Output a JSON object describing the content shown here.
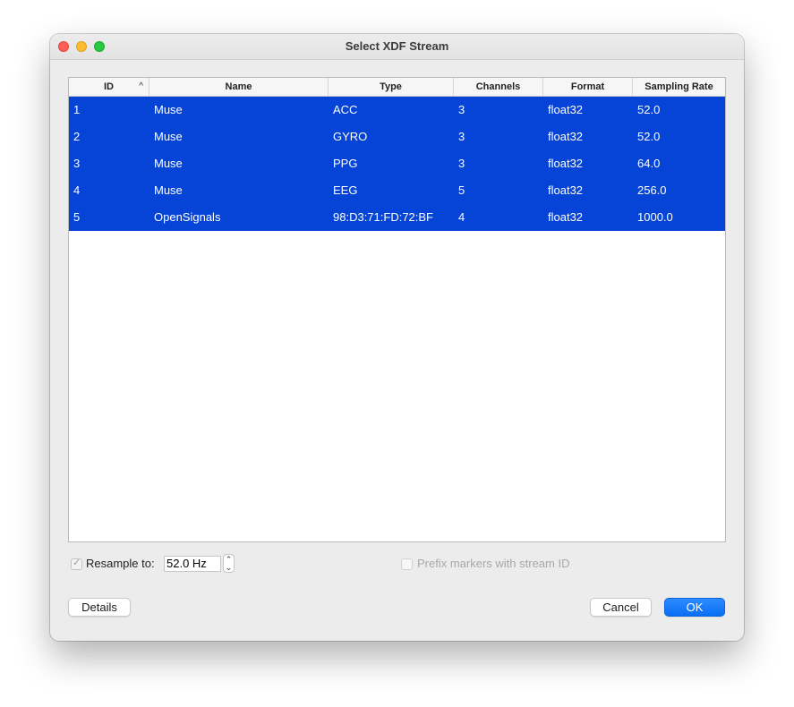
{
  "window": {
    "title": "Select XDF Stream"
  },
  "table": {
    "columns": [
      "ID",
      "Name",
      "Type",
      "Channels",
      "Format",
      "Sampling Rate"
    ],
    "sort_indicator": "^",
    "rows": [
      [
        "1",
        "Muse",
        "ACC",
        "3",
        "float32",
        "52.0"
      ],
      [
        "2",
        "Muse",
        "GYRO",
        "3",
        "float32",
        "52.0"
      ],
      [
        "3",
        "Muse",
        "PPG",
        "3",
        "float32",
        "64.0"
      ],
      [
        "4",
        "Muse",
        "EEG",
        "5",
        "float32",
        "256.0"
      ],
      [
        "5",
        "OpenSignals",
        "98:D3:71:FD:72:BF",
        "4",
        "float32",
        "1000.0"
      ]
    ],
    "selection_color": "#0644d7"
  },
  "options": {
    "resample_label": "Resample to:",
    "resample_checked": true,
    "resample_value": "52.0 Hz",
    "prefix_label": "Prefix markers with stream ID",
    "prefix_checked": false
  },
  "buttons": {
    "details": "Details",
    "cancel": "Cancel",
    "ok": "OK"
  },
  "icons": {
    "close": "close-icon",
    "minimize": "minimize-icon",
    "maximize": "maximize-icon",
    "sort": "chevron-up-icon",
    "check": "checkmark-icon",
    "stepper_up": "chevron-up-icon",
    "stepper_down": "chevron-down-icon"
  }
}
